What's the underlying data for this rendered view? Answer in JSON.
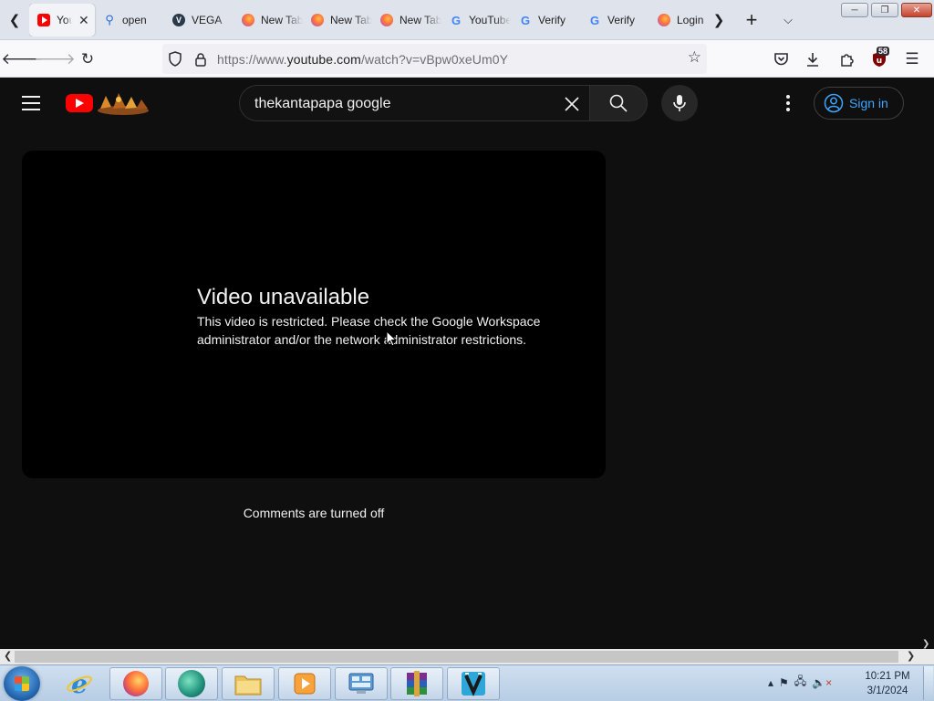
{
  "browser": {
    "tabs": [
      {
        "label": "YouTube",
        "icon": "youtube-favicon",
        "active": true
      },
      {
        "label": "open",
        "icon": "search-favicon"
      },
      {
        "label": "VEGA",
        "icon": "vega-favicon"
      },
      {
        "label": "New Tab",
        "icon": "firefox-favicon"
      },
      {
        "label": "New Tab",
        "icon": "firefox-favicon"
      },
      {
        "label": "New Tab",
        "icon": "firefox-favicon"
      },
      {
        "label": "YouTube",
        "icon": "google-favicon"
      },
      {
        "label": "Verify",
        "icon": "google-favicon"
      },
      {
        "label": "Verify",
        "icon": "google-favicon"
      },
      {
        "label": "Login",
        "icon": "firefox-favicon"
      }
    ],
    "url_prefix": "https://www.",
    "url_domain": "youtube.com",
    "url_path": "/watch?v=vBpw0xeUm0Y",
    "extension_badge": "58"
  },
  "youtube": {
    "search_query": "thekantapapa google",
    "sign_in_label": "Sign in",
    "accent_color": "#3ea6ff",
    "logo_color": "#ff0000"
  },
  "player": {
    "error_title": "Video unavailable",
    "error_line1": "This video is restricted. Please check the Google Workspace",
    "error_line2": "administrator and/or the network administrator restrictions."
  },
  "comments": {
    "status": "Comments are turned off"
  },
  "taskbar": {
    "time": "10:21 PM",
    "date": "3/1/2024"
  }
}
